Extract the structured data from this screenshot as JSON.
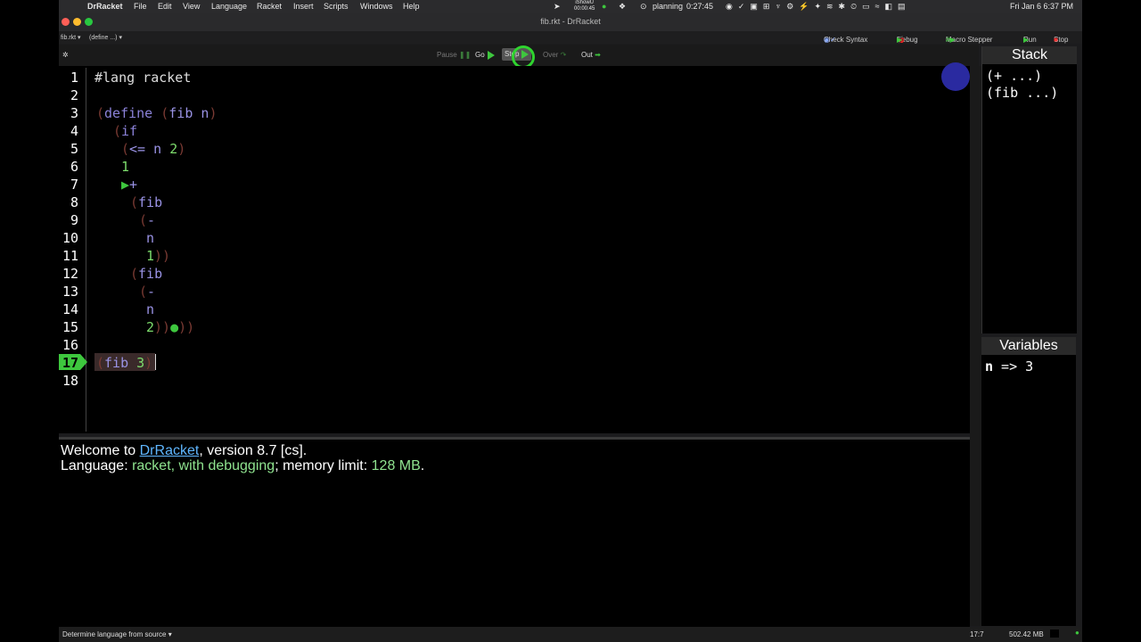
{
  "menubar": {
    "app": "DrRacket",
    "items": [
      "File",
      "Edit",
      "View",
      "Language",
      "Racket",
      "Insert",
      "Scripts",
      "Windows",
      "Help"
    ],
    "ishowu_top": "iShowU",
    "ishowu_time": "00:00:45",
    "planning": "planning",
    "planning_time": "0:27:45",
    "clock": "Fri Jan 6  6:37 PM"
  },
  "window": {
    "title": "fib.rkt - DrRacket"
  },
  "nav": {
    "file": "fib.rkt ▾",
    "define": "(define ...) ▾",
    "check_syntax": "Check Syntax",
    "debug": "Debug",
    "macro_stepper": "Macro Stepper",
    "run": "Run",
    "stop": "Stop"
  },
  "debugger": {
    "pause": "Pause",
    "go": "Go",
    "step": "Step",
    "over": "Over",
    "out": "Out"
  },
  "editor": {
    "line_numbers": [
      "1",
      "2",
      "3",
      "4",
      "5",
      "6",
      "7",
      "8",
      "9",
      "10",
      "11",
      "12",
      "13",
      "14",
      "15",
      "16",
      "17",
      "18"
    ],
    "current_line": "17",
    "lang": "#lang racket",
    "define_kw": "define",
    "fib": "fib",
    "n": "n",
    "if_kw": "if",
    "le": "<=",
    "two": "2",
    "one": "1",
    "plus": "+",
    "minus": "-",
    "three": "3"
  },
  "stack": {
    "header": "Stack",
    "items": [
      "(+ ...)",
      "(fib ...)"
    ]
  },
  "variables": {
    "header": "Variables",
    "var_name": "n",
    "var_value": " => 3"
  },
  "interactions": {
    "welcome_pre": "Welcome to ",
    "welcome_link": "DrRacket",
    "welcome_post": ", version 8.7 [cs].",
    "lang_pre": "Language: ",
    "lang_name": "racket, with debugging",
    "lang_mid": "; memory limit: ",
    "mem": "128 MB",
    "lang_post": "."
  },
  "status": {
    "language": "Determine language from source ▾",
    "position": "17:7",
    "memory": "502.42 MB"
  }
}
